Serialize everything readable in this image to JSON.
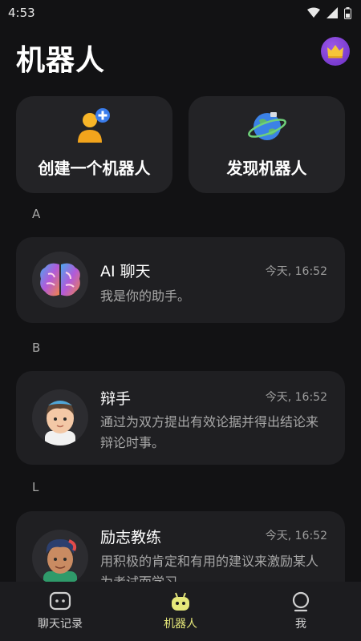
{
  "status": {
    "time": "4:53"
  },
  "header": {
    "title": "机器人"
  },
  "quick_actions": [
    {
      "label": "创建一个机器人"
    },
    {
      "label": "发现机器人"
    }
  ],
  "sections": [
    "A",
    "B",
    "L"
  ],
  "bots": [
    {
      "name": "AI 聊天",
      "time": "今天, 16:52",
      "desc": "我是你的助手。"
    },
    {
      "name": "辩手",
      "time": "今天, 16:52",
      "desc": "通过为双方提出有效论据并得出结论来辩论时事。"
    },
    {
      "name": "励志教练",
      "time": "今天, 16:52",
      "desc": "用积极的肯定和有用的建议来激励某人为考试而学习"
    }
  ],
  "tabs": [
    {
      "label": "聊天记录"
    },
    {
      "label": "机器人"
    },
    {
      "label": "我"
    }
  ],
  "colors": {
    "accent": "#e6e87a",
    "background": "#121214",
    "card": "#232326"
  }
}
